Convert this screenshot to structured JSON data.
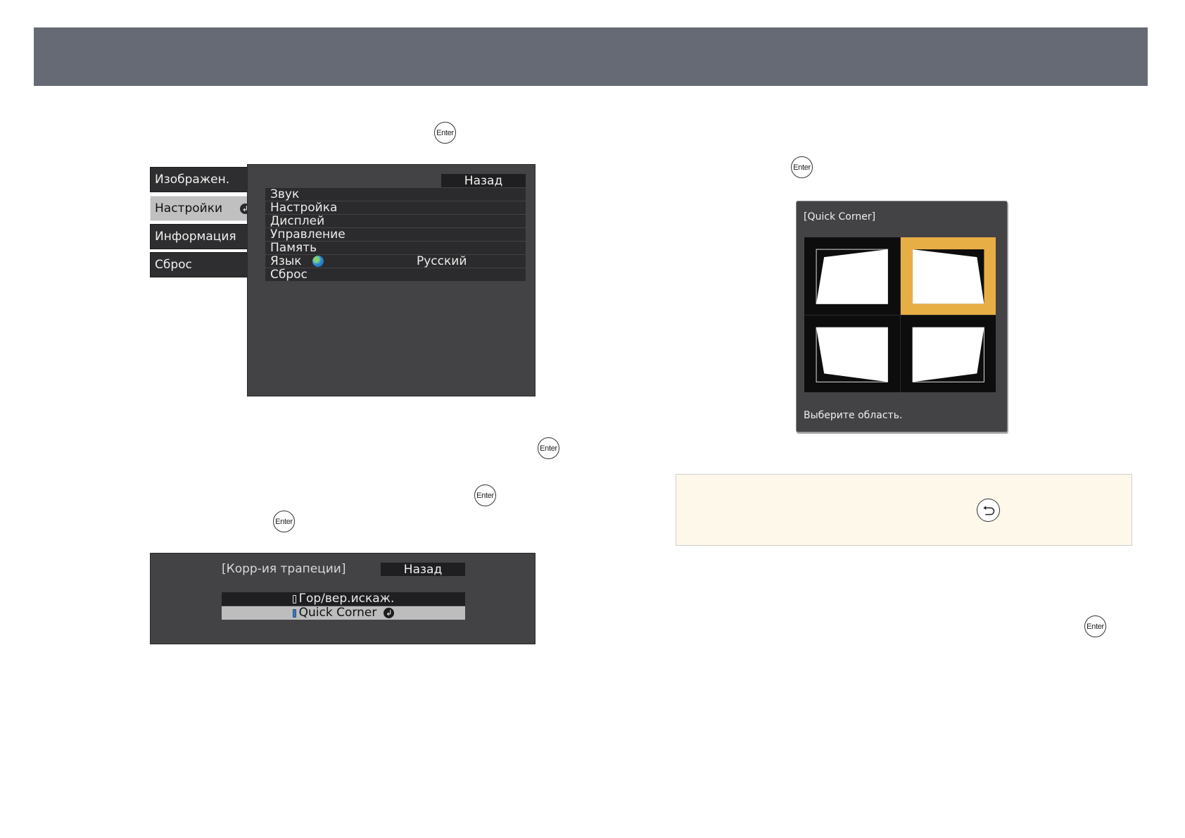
{
  "enter_button_label": "Enter",
  "settings_menu": {
    "tabs": [
      {
        "label": "Изображен."
      },
      {
        "label": "Настройки"
      },
      {
        "label": "Информация"
      },
      {
        "label": "Сброс"
      }
    ],
    "back_label": "Назад",
    "items": [
      {
        "label": "Звук",
        "value": ""
      },
      {
        "label": "Настройка",
        "value": ""
      },
      {
        "label": "Дисплей",
        "value": ""
      },
      {
        "label": "Управление",
        "value": ""
      },
      {
        "label": "Память",
        "value": ""
      },
      {
        "label": "Язык",
        "value": "Русский",
        "icon": "globe-icon"
      },
      {
        "label": "Сброс",
        "value": ""
      }
    ]
  },
  "keystone_menu": {
    "title": "[Корр-ия трапеции]",
    "back_label": "Назад",
    "options": [
      {
        "label": "Гор/вер.искаж.",
        "selected": false
      },
      {
        "label": "Quick Corner",
        "selected": true
      }
    ]
  },
  "quick_corner": {
    "title": "[Quick Corner]",
    "hint": "Выберите область.",
    "selected_region": "top-right",
    "active_color": "#e8ae46"
  },
  "note": {
    "icon": "return-icon"
  }
}
